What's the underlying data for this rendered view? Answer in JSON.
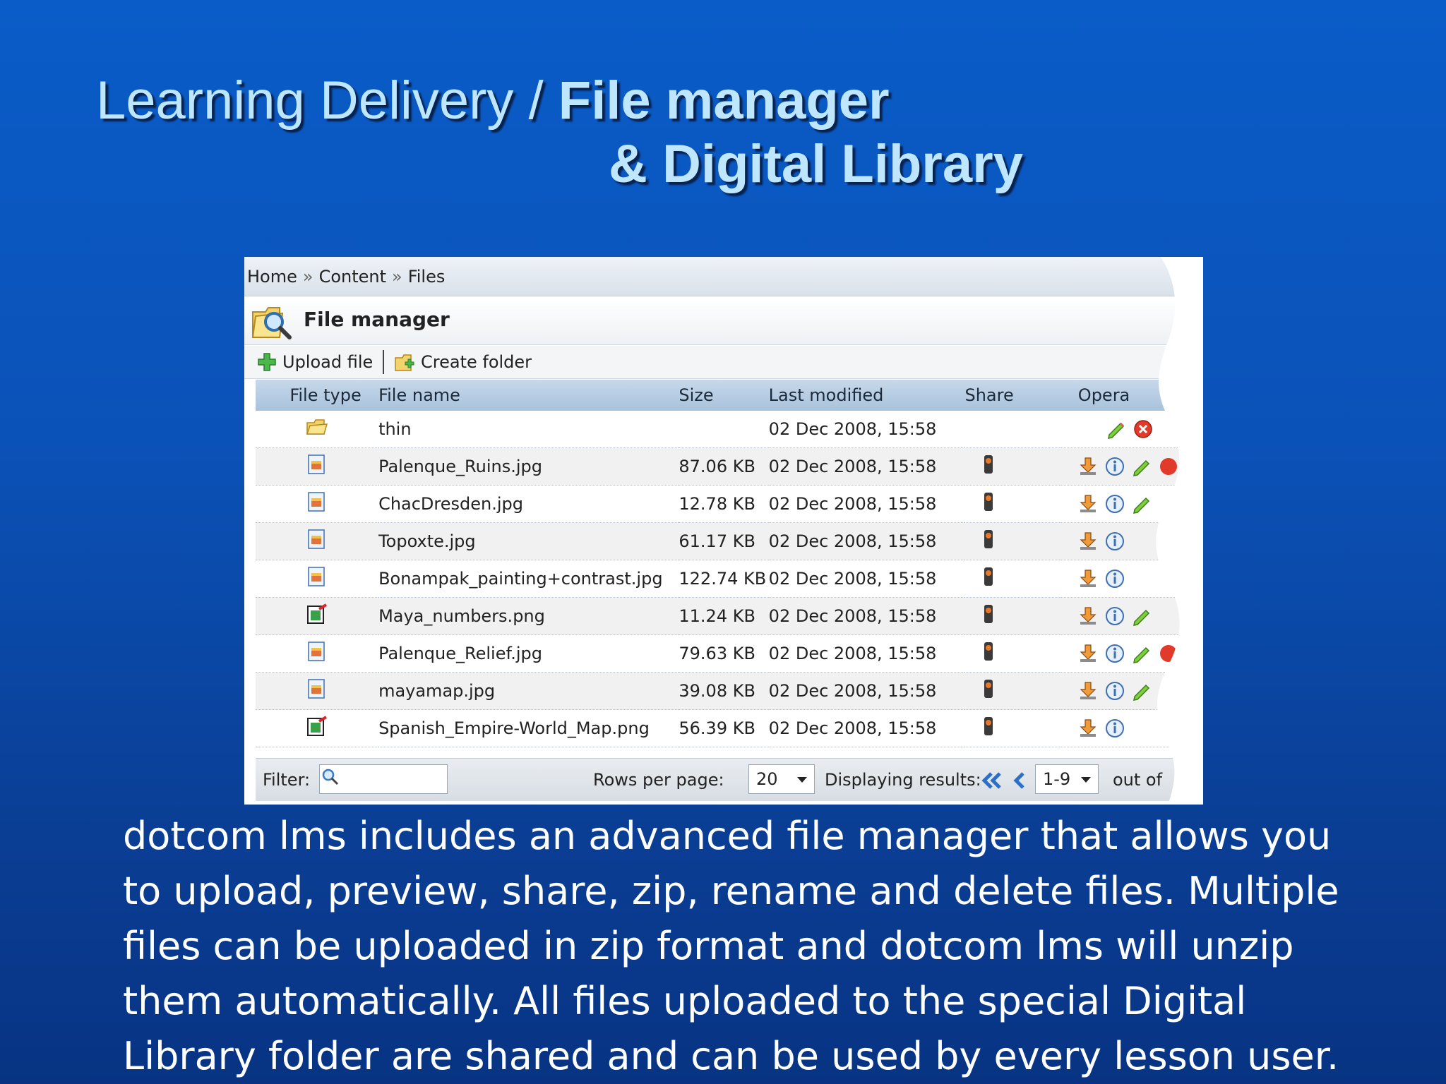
{
  "slide": {
    "title_part1": "Learning Delivery / ",
    "title_part2": "File manager",
    "title_line2": "& Digital Library",
    "caption": "dotcom lms includes an advanced file manager that allows you to upload, preview, share, zip, rename and delete files. Multiple files can be uploaded in zip format and dotcom lms will unzip them automatically. All files uploaded to the special Digital Library folder are shared and can be used by every lesson user."
  },
  "breadcrumb": {
    "home": "Home",
    "sep": "»",
    "content": "Content",
    "files": "Files"
  },
  "file_manager": {
    "title": "File manager",
    "upload_label": "Upload file",
    "create_folder_label": "Create folder"
  },
  "table": {
    "headers": {
      "type": "File type",
      "name": "File name",
      "size": "Size",
      "modified": "Last modified",
      "share": "Share",
      "ops": "Opera"
    },
    "rows": [
      {
        "type": "folder",
        "name": "thin",
        "size": "",
        "modified": "02 Dec 2008, 15:58"
      },
      {
        "type": "jpg",
        "name": "Palenque_Ruins.jpg",
        "size": "87.06 KB",
        "modified": "02 Dec 2008, 15:58"
      },
      {
        "type": "jpg",
        "name": "ChacDresden.jpg",
        "size": "12.78 KB",
        "modified": "02 Dec 2008, 15:58"
      },
      {
        "type": "jpg",
        "name": "Topoxte.jpg",
        "size": "61.17 KB",
        "modified": "02 Dec 2008, 15:58"
      },
      {
        "type": "jpg",
        "name": "Bonampak_painting+contrast.jpg",
        "size": "122.74 KB",
        "modified": "02 Dec 2008, 15:58"
      },
      {
        "type": "png",
        "name": "Maya_numbers.png",
        "size": "11.24 KB",
        "modified": "02 Dec 2008, 15:58"
      },
      {
        "type": "jpg",
        "name": "Palenque_Relief.jpg",
        "size": "79.63 KB",
        "modified": "02 Dec 2008, 15:58"
      },
      {
        "type": "jpg",
        "name": "mayamap.jpg",
        "size": "39.08 KB",
        "modified": "02 Dec 2008, 15:58"
      },
      {
        "type": "png",
        "name": "Spanish_Empire-World_Map.png",
        "size": "56.39 KB",
        "modified": "02 Dec 2008, 15:58"
      }
    ]
  },
  "footer": {
    "filter_label": "Filter:",
    "rows_per_page_label": "Rows per page:",
    "rows_per_page_value": "20",
    "displaying_label": "Displaying results:",
    "range_value": "1-9",
    "out_of_label": "out of"
  },
  "colors": {
    "title": "#bfe6ff",
    "header_bg": "#a8c2dc",
    "slide_bg": "#0a5cc8"
  }
}
